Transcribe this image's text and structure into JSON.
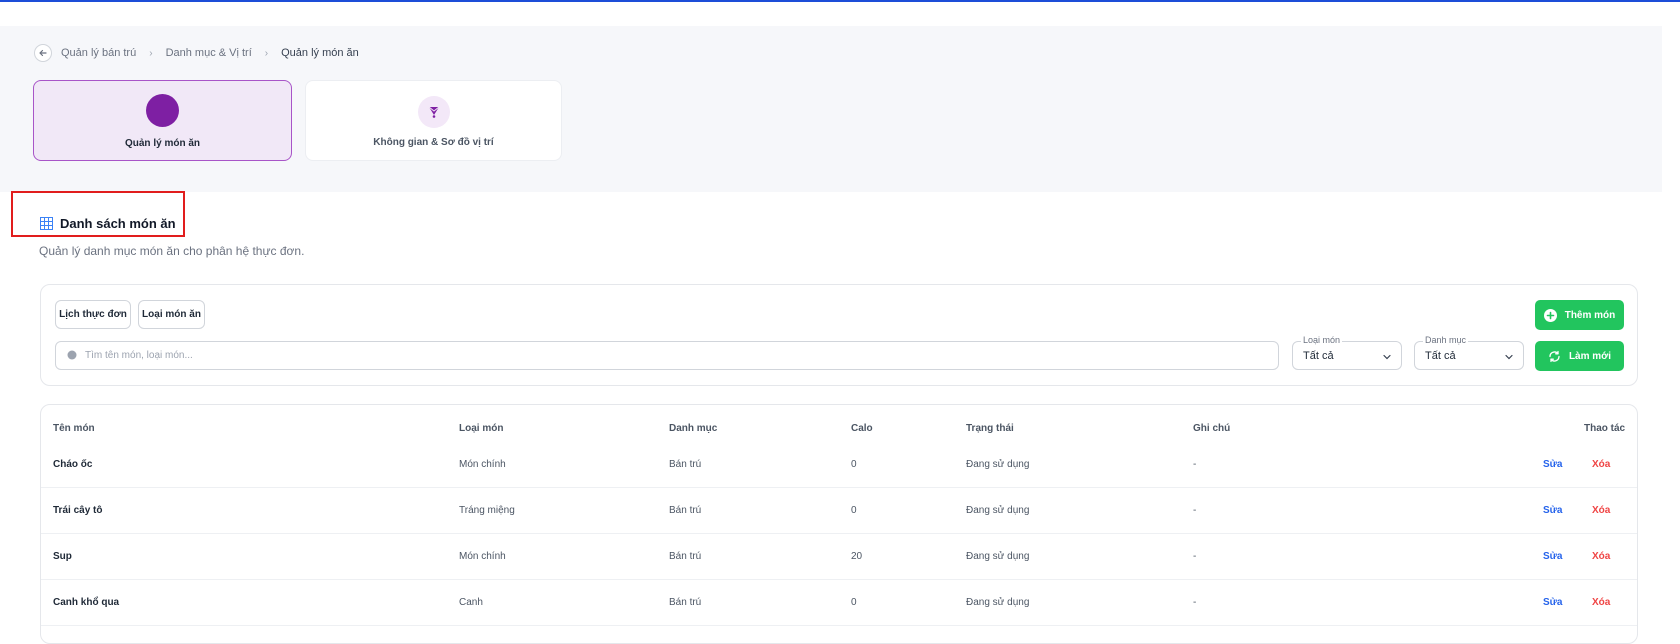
{
  "breadcrumb": {
    "items": [
      "Quản lý bán trú",
      "Danh mục & Vị trí",
      "Quản lý món ăn"
    ]
  },
  "modules": [
    {
      "label": "Quản lý món ăn",
      "active": true
    },
    {
      "label": "Không gian & Sơ đồ vị trí",
      "active": false
    }
  ],
  "section": {
    "title": "Danh sách món ăn",
    "subtitle": "Quản lý danh mục món ăn cho phân hệ thực đơn."
  },
  "filters": {
    "chips": [
      "Lịch thực đơn",
      "Loại món ăn"
    ],
    "search_placeholder": "Tìm tên món, loại món...",
    "type_select": {
      "label": "Loại món",
      "value": "Tất cả"
    },
    "category_select": {
      "label": "Danh mục",
      "value": "Tất cả"
    },
    "add_button": "Thêm món",
    "refresh_button": "Làm mới"
  },
  "table": {
    "headers": [
      "Tên món",
      "Loại món",
      "Danh mục",
      "Calo",
      "Trạng thái",
      "Ghi chú",
      "Thao tác"
    ],
    "edit_label": "Sửa",
    "delete_label": "Xóa",
    "rows": [
      {
        "name": "Cháo ốc",
        "type": "Món chính",
        "category": "Bán trú",
        "calo": "0",
        "status": "Đang sử dụng",
        "note": "-"
      },
      {
        "name": "Trái cây tô",
        "type": "Tráng miệng",
        "category": "Bán trú",
        "calo": "0",
        "status": "Đang sử dụng",
        "note": "-"
      },
      {
        "name": "Sup",
        "type": "Món chính",
        "category": "Bán trú",
        "calo": "20",
        "status": "Đang sử dụng",
        "note": "-"
      },
      {
        "name": "Canh khổ qua",
        "type": "Canh",
        "category": "Bán trú",
        "calo": "0",
        "status": "Đang sử dụng",
        "note": "-"
      }
    ]
  },
  "colors": {
    "accent_purple": "#7e1fa3",
    "success_green": "#22c55e",
    "link_blue": "#2563eb",
    "danger_red": "#ef4444",
    "highlight_red": "#e11d1d"
  }
}
